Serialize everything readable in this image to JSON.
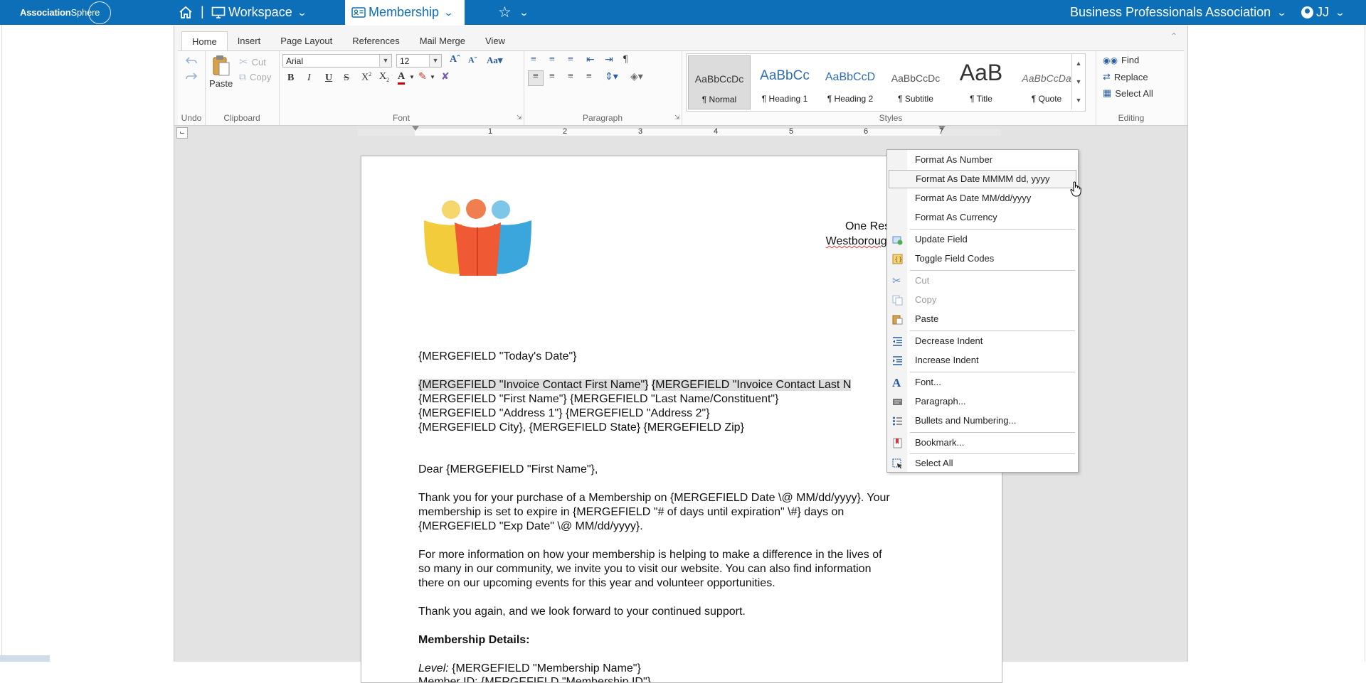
{
  "topbar": {
    "logo_text_1": "Association",
    "logo_text_2": "Sphere",
    "nav_sep": "|",
    "workspace": "Workspace",
    "membership": "Membership",
    "org_name": "Business Professionals Association",
    "user_initials": "JJ"
  },
  "ribbon": {
    "tabs": [
      "Home",
      "Insert",
      "Page Layout",
      "References",
      "Mail Merge",
      "View"
    ],
    "groups": {
      "undo": "Undo",
      "clipboard": "Clipboard",
      "font": "Font",
      "paragraph": "Paragraph",
      "styles": "Styles",
      "editing": "Editing"
    },
    "clipboard": {
      "paste": "Paste",
      "cut": "Cut",
      "copy": "Copy"
    },
    "font": {
      "family": "Arial",
      "size": "12"
    },
    "styles": [
      {
        "sample": "AaBbCcDc",
        "name": "¶ Normal"
      },
      {
        "sample": "AaBbCc",
        "name": "¶ Heading 1"
      },
      {
        "sample": "AaBbCcD",
        "name": "¶ Heading 2"
      },
      {
        "sample": "AaBbCcDc",
        "name": "¶ Subtitle"
      },
      {
        "sample": "AaB",
        "name": "¶ Title"
      },
      {
        "sample": "AaBbCcDa",
        "name": "¶ Quote"
      }
    ],
    "editing": {
      "find": "Find",
      "replace": "Replace",
      "select_all": "Select All"
    }
  },
  "ruler": {
    "numbers": [
      "1",
      "2",
      "3",
      "4",
      "5",
      "6",
      "7"
    ]
  },
  "document": {
    "address_line1": "One Rese",
    "address_line2": "Westborough,",
    "lines": [
      "{MERGEFIELD \"Today's Date\"}",
      "{MERGEFIELD \"Invoice Contact First Name\"}",
      "{MERGEFIELD \"Invoice Contact Last N",
      "{MERGEFIELD \"First Name\"} {MERGEFIELD \"Last Name/Constituent\"}",
      "{MERGEFIELD \"Address 1\"} {MERGEFIELD \"Address 2\"}",
      "{MERGEFIELD City}, {MERGEFIELD State} {MERGEFIELD Zip}",
      "Dear {MERGEFIELD \"First Name\"},",
      "Thank you for your purchase of a Membership on {MERGEFIELD Date \\@ MM/dd/yyyy}. Your",
      "membership is set to expire in {MERGEFIELD \"# of days until expiration\" \\#} days on",
      "{MERGEFIELD \"Exp Date\" \\@ MM/dd/yyyy}.",
      "For more information on how your membership is helping to make a difference in the lives of",
      "so many in our community, we invite you to visit our website. You can also find information",
      "there on our upcoming events for this year and volunteer opportunities.",
      "Thank you again, and we look forward to your continued support.",
      "Membership Details:",
      "Level:",
      " {MERGEFIELD \"Membership Name\"}",
      "Member ID: {MERGEFIELD \"Membership ID\"}"
    ]
  },
  "context_menu": {
    "items": [
      "Format As Number",
      "Format As Date MMMM dd, yyyy",
      "Format As Date MM/dd/yyyy",
      "Format As Currency",
      "Update Field",
      "Toggle Field Codes",
      "Cut",
      "Copy",
      "Paste",
      "Decrease Indent",
      "Increase Indent",
      "Font...",
      "Paragraph...",
      "Bullets and Numbering...",
      "Bookmark...",
      "Select All"
    ]
  },
  "colors": {
    "brand_blue": "#0d6fb8",
    "menu_border": "#a9a9a9",
    "highlight_gray": "#dedede"
  }
}
